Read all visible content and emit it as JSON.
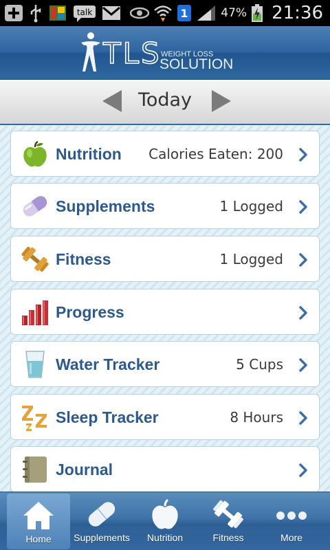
{
  "status_bar": {
    "battery_percent": "47%",
    "time": "21:36",
    "notification_badge": "1",
    "talk_label": "talk"
  },
  "header": {
    "logo_text": "TLS",
    "logo_tagline_top": "WEIGHT LOSS",
    "logo_tagline_bottom": "SOLUTION"
  },
  "date_nav": {
    "label": "Today"
  },
  "rows": [
    {
      "title": "Nutrition",
      "value": "Calories Eaten: 200",
      "icon": "apple-icon"
    },
    {
      "title": "Supplements",
      "value": "1 Logged",
      "icon": "pill-icon"
    },
    {
      "title": "Fitness",
      "value": "1 Logged",
      "icon": "dumbbell-icon"
    },
    {
      "title": "Progress",
      "value": "",
      "icon": "bar-chart-icon"
    },
    {
      "title": "Water Tracker",
      "value": "5 Cups",
      "icon": "water-glass-icon"
    },
    {
      "title": "Sleep Tracker",
      "value": "8 Hours",
      "icon": "sleep-zzz-icon"
    },
    {
      "title": "Journal",
      "value": "",
      "icon": "notebook-icon"
    }
  ],
  "tabs": [
    {
      "label": "Home",
      "icon": "home-icon",
      "active": true
    },
    {
      "label": "Supplements",
      "icon": "pill-icon",
      "active": false
    },
    {
      "label": "Nutrition",
      "icon": "apple-icon",
      "active": false
    },
    {
      "label": "Fitness",
      "icon": "dumbbell-icon",
      "active": false
    },
    {
      "label": "More",
      "icon": "more-dots-icon",
      "active": false
    }
  ],
  "colors": {
    "brand_blue": "#2f64a0",
    "row_title": "#2c5a8c",
    "chevron": "#3d6ea6"
  }
}
